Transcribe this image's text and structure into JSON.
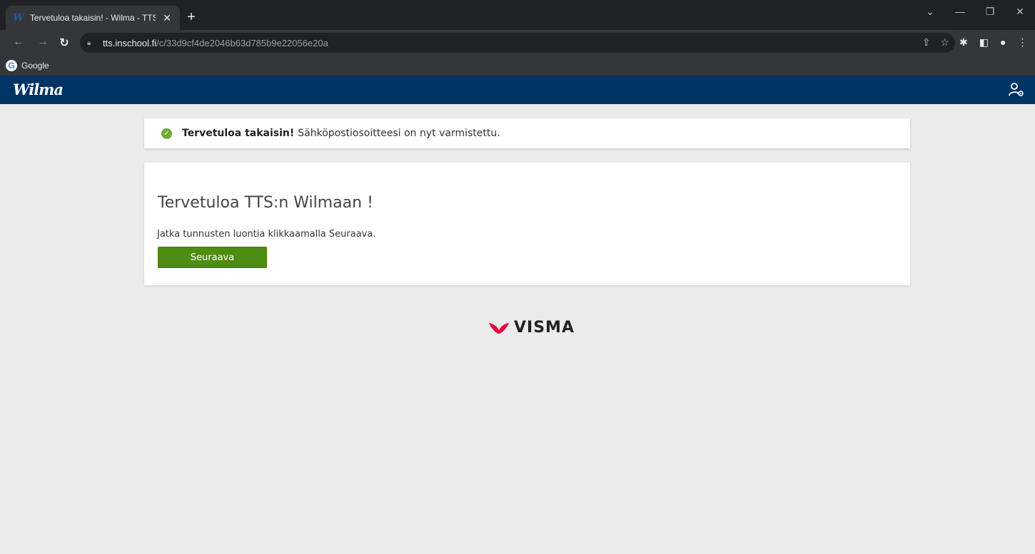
{
  "browser": {
    "tab_title": "Tervetuloa takaisin! - Wilma - TTS",
    "tab_favicon": "W",
    "url_host": "tts.inschool.fi",
    "url_path": "/c/33d9cf4de2046b63d785b9e22056e20a",
    "bookmark_label": "Google",
    "icons": [
      "back-icon",
      "forward-icon",
      "reload-icon",
      "lock-icon",
      "share-icon",
      "star-icon",
      "extensions-icon",
      "side-panel-icon",
      "profile-icon",
      "menu-icon"
    ]
  },
  "header": {
    "logo": "Wilma",
    "brand_color": "#003366"
  },
  "alert": {
    "strong": "Tervetuloa takaisin!",
    "message": "Sähköpostiosoitteesi on nyt varmistettu.",
    "icon": "check-circle-icon",
    "icon_color": "#6cab36"
  },
  "welcome": {
    "title": "Tervetuloa TTS:n Wilmaan !",
    "instruction": "Jatka tunnusten luontia klikkaamalla Seuraava.",
    "next_label": "Seuraava",
    "button_color": "#4f8c12"
  },
  "footer": {
    "brand": "VISMA",
    "mark_color": "#e4003a"
  }
}
